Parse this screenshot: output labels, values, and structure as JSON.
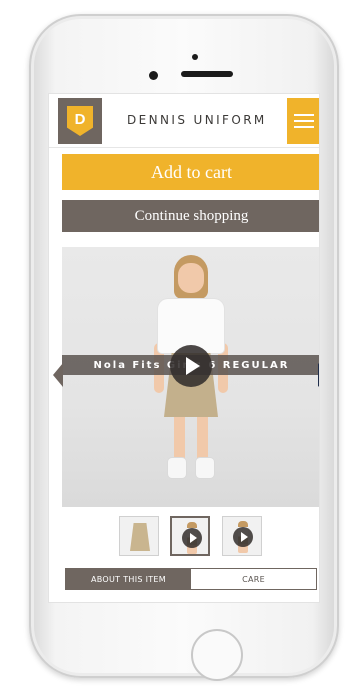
{
  "header": {
    "logo_letter": "D",
    "brand": "DENNIS UNIFORM",
    "menu_icon": "hamburger-icon"
  },
  "actions": {
    "add_to_cart": "Add to cart",
    "continue_shopping": "Continue shopping"
  },
  "media": {
    "caption": "Nola Fits Girls 6 REGULAR",
    "play_icon": "play-icon",
    "prev_icon": "chevron-left-icon",
    "next_icon": "chevron-right-icon"
  },
  "thumbnails": [
    {
      "type": "image",
      "selected": false
    },
    {
      "type": "video",
      "selected": true
    },
    {
      "type": "video",
      "selected": false
    }
  ],
  "tabs": [
    {
      "label": "ABOUT THIS ITEM",
      "active": true
    },
    {
      "label": "CARE",
      "active": false
    }
  ],
  "colors": {
    "accent_yellow": "#f0b32b",
    "brand_taupe": "#6f6660",
    "arrow_navy": "#1f2d4a"
  }
}
